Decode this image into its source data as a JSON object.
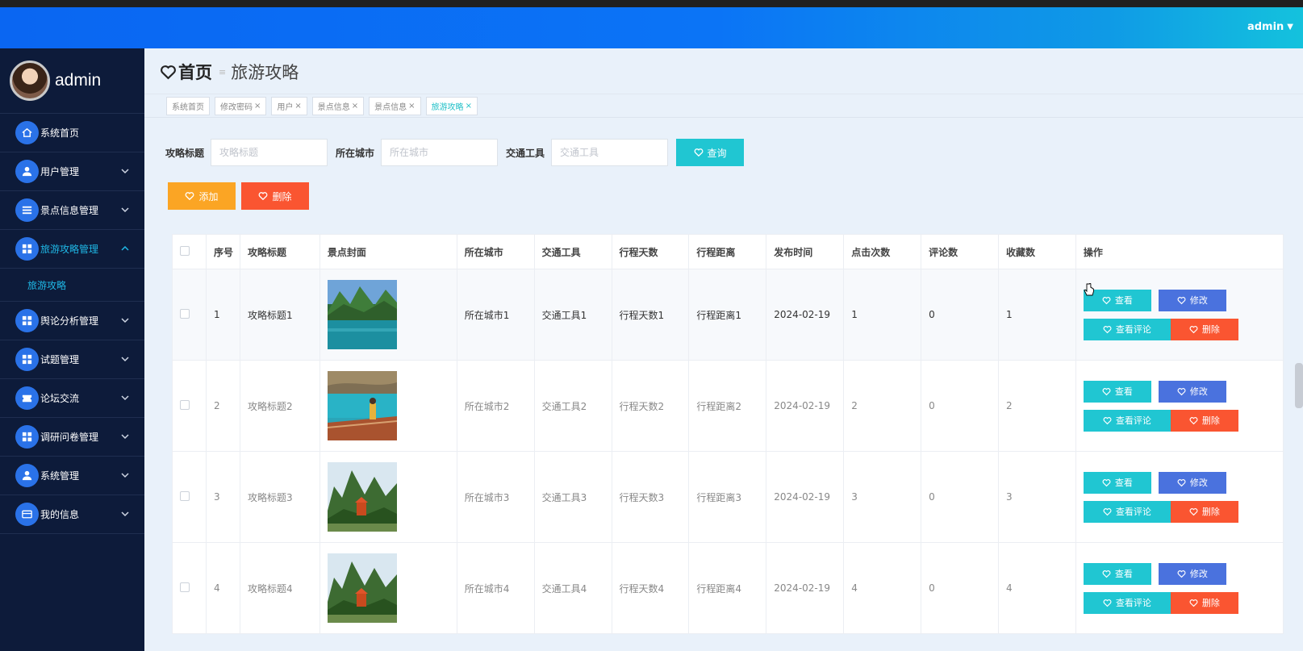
{
  "header": {
    "user_menu": "admin"
  },
  "sidebar": {
    "username": "admin",
    "items": [
      {
        "label": "系统首页",
        "icon": "home-icon",
        "chevron": false
      },
      {
        "label": "用户管理",
        "icon": "user-icon",
        "chevron": true
      },
      {
        "label": "景点信息管理",
        "icon": "list-icon",
        "chevron": true
      },
      {
        "label": "旅游攻略管理",
        "icon": "grid-icon",
        "chevron": true,
        "active": true
      },
      {
        "label": "舆论分析管理",
        "icon": "grid-icon",
        "chevron": true
      },
      {
        "label": "试题管理",
        "icon": "grid-icon",
        "chevron": true
      },
      {
        "label": "论坛交流",
        "icon": "ticket-icon",
        "chevron": true
      },
      {
        "label": "调研问卷管理",
        "icon": "grid-icon",
        "chevron": true
      },
      {
        "label": "系统管理",
        "icon": "user-icon",
        "chevron": true
      },
      {
        "label": "我的信息",
        "icon": "card-icon",
        "chevron": true
      }
    ],
    "submenu": {
      "label": "旅游攻略"
    }
  },
  "breadcrumb": {
    "home": "首页",
    "current": "旅游攻略"
  },
  "tags": [
    {
      "label": "系统首页",
      "closable": false
    },
    {
      "label": "修改密码",
      "closable": true
    },
    {
      "label": "用户",
      "closable": true
    },
    {
      "label": "景点信息",
      "closable": true
    },
    {
      "label": "景点信息",
      "closable": true
    },
    {
      "label": "旅游攻略",
      "closable": true,
      "active": true
    }
  ],
  "search": {
    "title_label": "攻略标题",
    "title_placeholder": "攻略标题",
    "city_label": "所在城市",
    "city_placeholder": "所在城市",
    "transport_label": "交通工具",
    "transport_placeholder": "交通工具",
    "button": "查询"
  },
  "actions": {
    "add": "添加",
    "delete": "删除"
  },
  "table": {
    "headers": [
      "序号",
      "攻略标题",
      "景点封面",
      "所在城市",
      "交通工具",
      "行程天数",
      "行程距离",
      "发布时间",
      "点击次数",
      "评论数",
      "收藏数",
      "操作"
    ],
    "row_buttons": {
      "view": "查看",
      "edit": "修改",
      "comments": "查看评论",
      "delete": "删除"
    },
    "rows": [
      {
        "no": "1",
        "title": "攻略标题1",
        "cover": "lake",
        "city": "所在城市1",
        "transport": "交通工具1",
        "days": "行程天数1",
        "distance": "行程距离1",
        "date": "2024-02-19",
        "clicks": "1",
        "comments": "0",
        "favorites": "1"
      },
      {
        "no": "2",
        "title": "攻略标题2",
        "cover": "boardwalk",
        "city": "所在城市2",
        "transport": "交通工具2",
        "days": "行程天数2",
        "distance": "行程距离2",
        "date": "2024-02-19",
        "clicks": "2",
        "comments": "0",
        "favorites": "2"
      },
      {
        "no": "3",
        "title": "攻略标题3",
        "cover": "karst",
        "city": "所在城市3",
        "transport": "交通工具3",
        "days": "行程天数3",
        "distance": "行程距离3",
        "date": "2024-02-19",
        "clicks": "3",
        "comments": "0",
        "favorites": "3"
      },
      {
        "no": "4",
        "title": "攻略标题4",
        "cover": "karst",
        "city": "所在城市4",
        "transport": "交通工具4",
        "days": "行程天数4",
        "distance": "行程距离4",
        "date": "2024-02-19",
        "clicks": "4",
        "comments": "0",
        "favorites": "4"
      }
    ]
  },
  "colors": {
    "sidebar": "#0d1b3a",
    "accent": "#20c6d2",
    "edit": "#4a72de",
    "danger": "#fa5531",
    "add": "#fba524",
    "header": "#0b74f6"
  }
}
